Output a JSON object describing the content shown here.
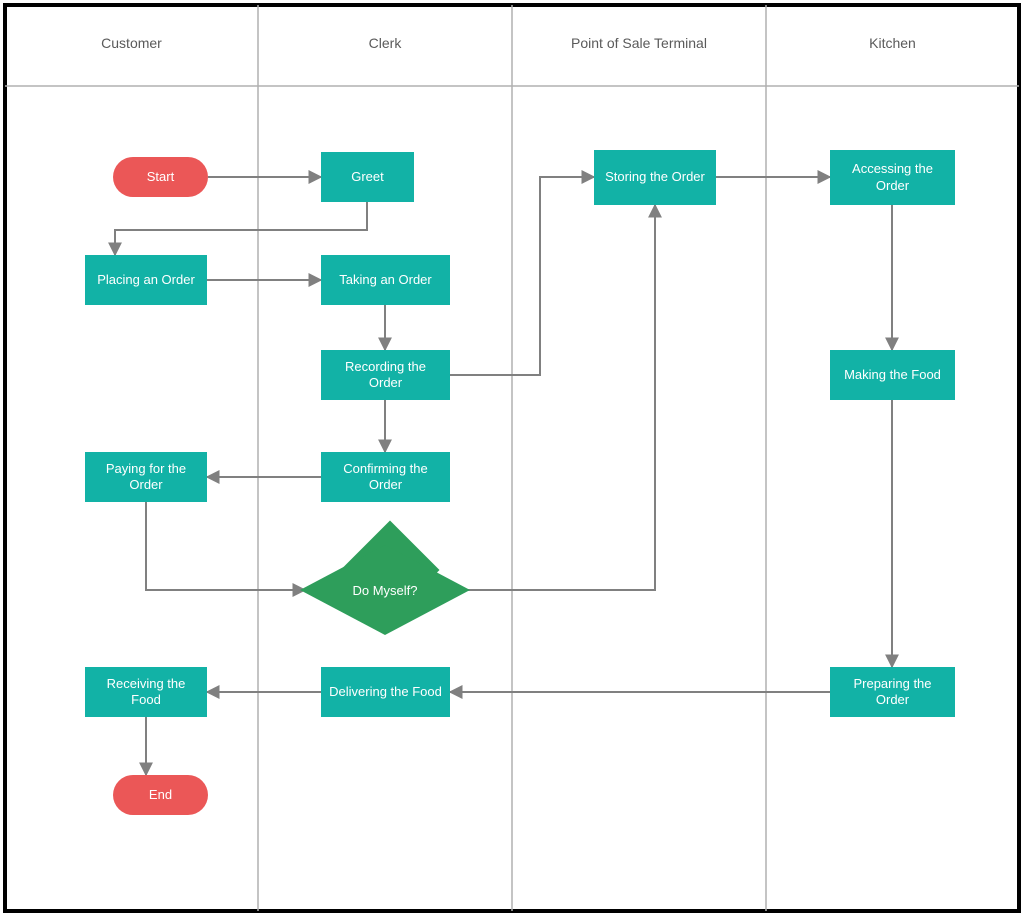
{
  "swimlane": {
    "lanes": [
      {
        "id": "customer",
        "label": "Customer"
      },
      {
        "id": "clerk",
        "label": "Clerk"
      },
      {
        "id": "pos",
        "label": "Point of Sale Terminal"
      },
      {
        "id": "kitchen",
        "label": "Kitchen"
      }
    ],
    "nodes": {
      "start": {
        "lane": "customer",
        "type": "terminator",
        "label": "Start"
      },
      "greet": {
        "lane": "clerk",
        "type": "process",
        "label": "Greet"
      },
      "placing": {
        "lane": "customer",
        "type": "process",
        "label": "Placing an Order"
      },
      "taking": {
        "lane": "clerk",
        "type": "process",
        "label": "Taking an Order"
      },
      "recording": {
        "lane": "clerk",
        "type": "process",
        "label": "Recording the Order"
      },
      "confirming": {
        "lane": "clerk",
        "type": "process",
        "label": "Confirming the Order"
      },
      "paying": {
        "lane": "customer",
        "type": "process",
        "label": "Paying for the Order"
      },
      "decision": {
        "lane": "clerk",
        "type": "decision",
        "label": "Do Myself?"
      },
      "storing": {
        "lane": "pos",
        "type": "process",
        "label": "Storing the Order"
      },
      "accessing": {
        "lane": "kitchen",
        "type": "process",
        "label": "Accessing the Order"
      },
      "making": {
        "lane": "kitchen",
        "type": "process",
        "label": "Making the Food"
      },
      "preparing": {
        "lane": "kitchen",
        "type": "process",
        "label": "Preparing the Order"
      },
      "delivering": {
        "lane": "clerk",
        "type": "process",
        "label": "Delivering the Food"
      },
      "receiving": {
        "lane": "customer",
        "type": "process",
        "label": "Receiving the Food"
      },
      "end": {
        "lane": "customer",
        "type": "terminator",
        "label": "End"
      }
    },
    "edges": [
      [
        "start",
        "greet"
      ],
      [
        "greet",
        "placing"
      ],
      [
        "placing",
        "taking"
      ],
      [
        "taking",
        "recording"
      ],
      [
        "recording",
        "confirming"
      ],
      [
        "confirming",
        "paying"
      ],
      [
        "paying",
        "decision"
      ],
      [
        "recording",
        "storing"
      ],
      [
        "decision",
        "storing"
      ],
      [
        "storing",
        "accessing"
      ],
      [
        "accessing",
        "making"
      ],
      [
        "making",
        "preparing"
      ],
      [
        "preparing",
        "delivering"
      ],
      [
        "delivering",
        "receiving"
      ],
      [
        "receiving",
        "end"
      ]
    ]
  },
  "colors": {
    "process": "#12b2a6",
    "terminator": "#eb5757",
    "decision": "#2e9e5b",
    "line": "#808080",
    "grid": "#b0b0b0",
    "border": "#000000"
  }
}
